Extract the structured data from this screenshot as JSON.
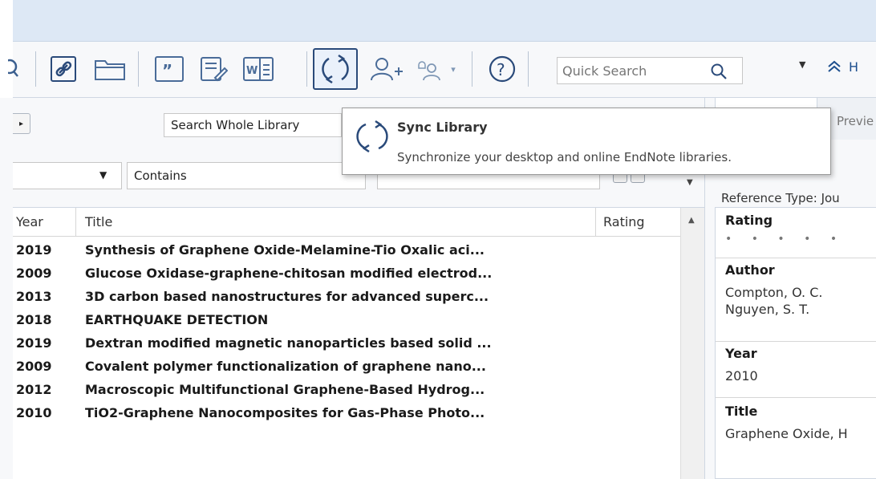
{
  "toolbar": {
    "quick_search_placeholder": "Quick Search",
    "hide_label": "H"
  },
  "search_panel": {
    "scope": "Search Whole Library",
    "operator": "Contains"
  },
  "tooltip": {
    "title": "Sync Library",
    "description": "Synchronize your desktop and online EndNote libraries."
  },
  "list": {
    "columns": {
      "year": "Year",
      "title": "Title",
      "rating": "Rating"
    },
    "rows": [
      {
        "year": "2019",
        "title": "Synthesis of Graphene Oxide-Melamine-Tio Oxalic aci..."
      },
      {
        "year": "2009",
        "title": "Glucose Oxidase-graphene-chitosan modified electrod..."
      },
      {
        "year": "2013",
        "title": "3D carbon based nanostructures for advanced superc..."
      },
      {
        "year": "2018",
        "title": "EARTHQUAKE DETECTION"
      },
      {
        "year": "2019",
        "title": "Dextran modified magnetic nanoparticles based solid ..."
      },
      {
        "year": "2009",
        "title": "Covalent polymer functionalization of graphene nano..."
      },
      {
        "year": "2012",
        "title": "Macroscopic Multifunctional Graphene-Based Hydrog..."
      },
      {
        "year": "2010",
        "title": "TiO2-Graphene Nanocomposites for Gas-Phase Photo..."
      }
    ]
  },
  "reference": {
    "tab_preview": "Previe",
    "reference_type_label": "Reference Type: Jou",
    "rating_label": "Rating",
    "rating_dots": "• • • • •",
    "author_label": "Author",
    "authors": [
      "Compton, O. C.",
      "Nguyen, S. T."
    ],
    "year_label": "Year",
    "year": "2010",
    "title_label": "Title",
    "title": "Graphene Oxide, H"
  },
  "colors": {
    "accent": "#1e4f8e",
    "titlebar": "#dde8f5",
    "panel": "#f7f8fa"
  }
}
